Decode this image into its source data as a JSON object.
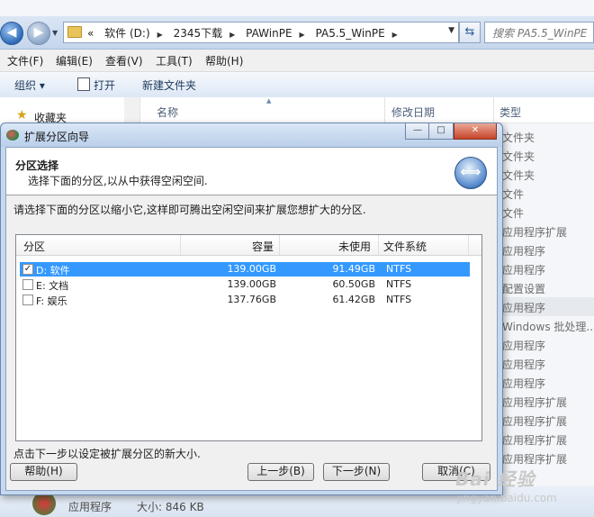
{
  "explorer": {
    "breadcrumbs": [
      "软件 (D:)",
      "2345下载",
      "PAWinPE",
      "PA5.5_WinPE"
    ],
    "crumb_prefix": "«",
    "search_placeholder": "搜索 PA5.5_WinPE",
    "menu": [
      "文件(F)",
      "编辑(E)",
      "查看(V)",
      "工具(T)",
      "帮助(H)"
    ],
    "commands": {
      "organize": "组织 ▾",
      "open": "打开",
      "new_folder": "新建文件夹"
    },
    "nav": {
      "favorites": "收藏夹"
    },
    "columns": {
      "name": "名称",
      "modified": "修改日期",
      "type": "类型"
    },
    "type_values": [
      "文件夹",
      "文件夹",
      "文件夹",
      "文件",
      "文件",
      "应用程序扩展",
      "应用程序",
      "应用程序",
      "配置设置",
      "应用程序",
      "Windows 批处理...",
      "应用程序",
      "应用程序",
      "应用程序",
      "应用程序扩展",
      "应用程序扩展",
      "应用程序扩展",
      "应用程序扩展"
    ],
    "selected_type_index": 9,
    "status": {
      "type": "应用程序",
      "size": "大小: 846 KB"
    },
    "watermark": "Bai 经验",
    "watermark2": "jingyan.baidu.com"
  },
  "dialog": {
    "title": "扩展分区向导",
    "window_buttons": {
      "minimize": "—",
      "maximize": "□",
      "close": "✕"
    },
    "header": {
      "title": "分区选择",
      "subtitle": "选择下面的分区,以从中获得空闲空间."
    },
    "instruction": "请选择下面的分区以缩小它,这样即可腾出空闲空间来扩展您想扩大的分区.",
    "table": {
      "columns": [
        "分区",
        "容量",
        "未使用",
        "文件系统"
      ],
      "rows": [
        {
          "checked": true,
          "check_mark": "✓",
          "name": "D: 软件",
          "capacity": "139.00GB",
          "unused": "91.49GB",
          "fs": "NTFS"
        },
        {
          "checked": false,
          "check_mark": "",
          "name": "E: 文档",
          "capacity": "139.00GB",
          "unused": "60.50GB",
          "fs": "NTFS"
        },
        {
          "checked": false,
          "check_mark": "",
          "name": "F: 娱乐",
          "capacity": "137.76GB",
          "unused": "61.42GB",
          "fs": "NTFS"
        }
      ]
    },
    "footer_hint": "点击下一步以设定被扩展分区的新大小.",
    "buttons": {
      "help": "帮助(H)",
      "back": "上一步(B)",
      "next": "下一步(N)",
      "cancel": "取消(C)"
    }
  }
}
